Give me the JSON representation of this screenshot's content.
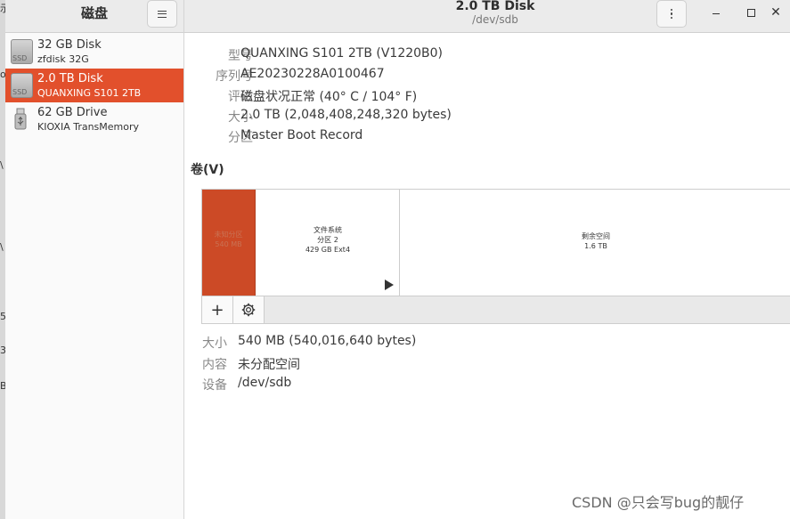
{
  "header": {
    "sidebar_title": "磁盘",
    "title": "2.0 TB Disk",
    "subtitle": "/dev/sdb"
  },
  "sidebar": {
    "disks": [
      {
        "name": "32 GB Disk",
        "sub": "zfdisk 32G",
        "icon": "hdd-icon",
        "icon_text": "SSD",
        "selected": false
      },
      {
        "name": "2.0 TB Disk",
        "sub": "QUANXING S101 2TB",
        "icon": "hdd-icon",
        "icon_text": "SSD",
        "selected": true
      },
      {
        "name": "62 GB Drive",
        "sub": "KIOXIA TransMemory",
        "icon": "usb-drive-icon",
        "selected": false
      }
    ]
  },
  "drive_info": {
    "model_label": "型号",
    "model_value": "QUANXING S101 2TB (V1220B0)",
    "serial_label": "序列号",
    "serial_value": "AE20230228A0100467",
    "assessment_label": "评估",
    "assessment_value": "磁盘状况正常 (40° C / 104° F)",
    "size_label": "大小",
    "size_value": "2.0 TB (2,048,408,248,320 bytes)",
    "partitioning_label": "分区",
    "partitioning_value": "Master Boot Record"
  },
  "volumes": {
    "section_title": "卷(V)",
    "blocks": [
      {
        "line1": "未知分区",
        "line2": "540 MB",
        "selected": true
      },
      {
        "line1": "文件系统",
        "line2": "分区 2",
        "line3": "429 GB Ext4",
        "selected": false
      },
      {
        "line1": "剩余空间",
        "line2": "1.6 TB",
        "selected": false
      }
    ],
    "toolbar": {
      "add_label": "+"
    }
  },
  "selected_volume": {
    "size_label": "大小",
    "size_value": "540 MB (540,016,640 bytes)",
    "contents_label": "内容",
    "contents_value": "未分配空间",
    "device_label": "设备",
    "device_value": "/dev/sdb"
  },
  "watermark": "CSDN @只会写bug的靓仔",
  "colors": {
    "accent": "#e2502c",
    "selected_volume": "#cc4a26",
    "header_bg": "#ebebeb"
  }
}
